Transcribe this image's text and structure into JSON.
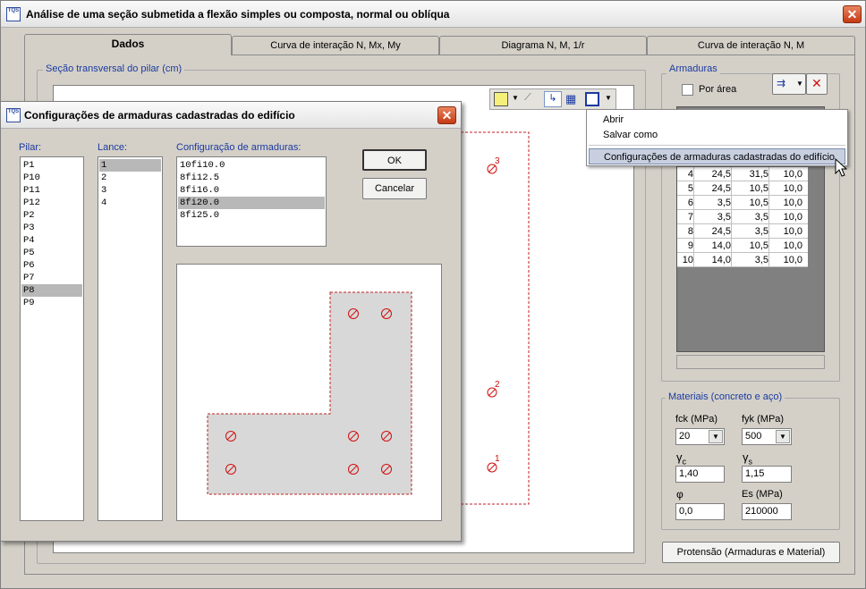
{
  "window": {
    "title": "Análise de uma seção submetida a flexão simples ou composta, normal ou oblíqua",
    "icon_text": "TQS",
    "close_glyph": "✕"
  },
  "tabs": [
    {
      "label": "Dados",
      "active": true
    },
    {
      "label": "Curva de interação N, Mx, My",
      "active": false
    },
    {
      "label": "Diagrama N, M, 1/r",
      "active": false
    },
    {
      "label": "Curva de interação N, M",
      "active": false
    }
  ],
  "section_group": {
    "legend": "Seção transversal do pilar (cm)",
    "bar_labels": [
      "3",
      "2",
      "1"
    ]
  },
  "armaduras": {
    "legend": "Armaduras",
    "por_area_label": "Por área",
    "por_area_checked": false,
    "table_rows": [
      {
        "n": "4",
        "x": "24,5",
        "y": "31,5",
        "d": "10,0"
      },
      {
        "n": "5",
        "x": "24,5",
        "y": "10,5",
        "d": "10,0"
      },
      {
        "n": "6",
        "x": "3,5",
        "y": "10,5",
        "d": "10,0"
      },
      {
        "n": "7",
        "x": "3,5",
        "y": "3,5",
        "d": "10,0"
      },
      {
        "n": "8",
        "x": "24,5",
        "y": "3,5",
        "d": "10,0"
      },
      {
        "n": "9",
        "x": "14,0",
        "y": "10,5",
        "d": "10,0"
      },
      {
        "n": "10",
        "x": "14,0",
        "y": "3,5",
        "d": "10,0"
      }
    ]
  },
  "menu": {
    "items": [
      {
        "label": "Abrir",
        "highlighted": false
      },
      {
        "label": "Salvar como",
        "highlighted": false
      },
      {
        "label": "Configurações de armaduras cadastradas do edifício",
        "highlighted": true
      }
    ]
  },
  "materiais": {
    "legend": "Materiais (concreto e aço)",
    "fck_label": "fck (MPa)",
    "fck_value": "20",
    "fyk_label": "fyk (MPa)",
    "fyk_value": "500",
    "gamma_c_symbol": "γ",
    "gamma_c_sub": "c",
    "gamma_c_value": "1,40",
    "gamma_s_symbol": "γ",
    "gamma_s_sub": "s",
    "gamma_s_value": "1,15",
    "phi_label": "φ",
    "phi_value": "0,0",
    "es_label": "Es (MPa)",
    "es_value": "210000"
  },
  "protensao_button": "Protensão (Armaduras e Material)",
  "dialog": {
    "title": "Configurações de armaduras cadastradas do edifício",
    "pilar_label": "Pilar:",
    "pilares": [
      "P1",
      "P10",
      "P11",
      "P12",
      "P2",
      "P3",
      "P4",
      "P5",
      "P6",
      "P7",
      "P8",
      "P9"
    ],
    "pilar_selected": "P8",
    "lance_label": "Lance:",
    "lances": [
      "1",
      "2",
      "3",
      "4"
    ],
    "lance_selected": "1",
    "config_label": "Configuração de armaduras:",
    "configs": [
      "10fi10.0",
      "8fi12.5",
      "8fi16.0",
      "8fi20.0",
      "8fi25.0"
    ],
    "config_selected": "8fi20.0",
    "ok_label": "OK",
    "cancel_label": "Cancelar"
  },
  "colors": {
    "accent_blue": "#1a3aa0",
    "rebar_red": "#d01010",
    "selection_gray": "#b8b8b8",
    "menu_highlight": "#c8d0e0"
  }
}
